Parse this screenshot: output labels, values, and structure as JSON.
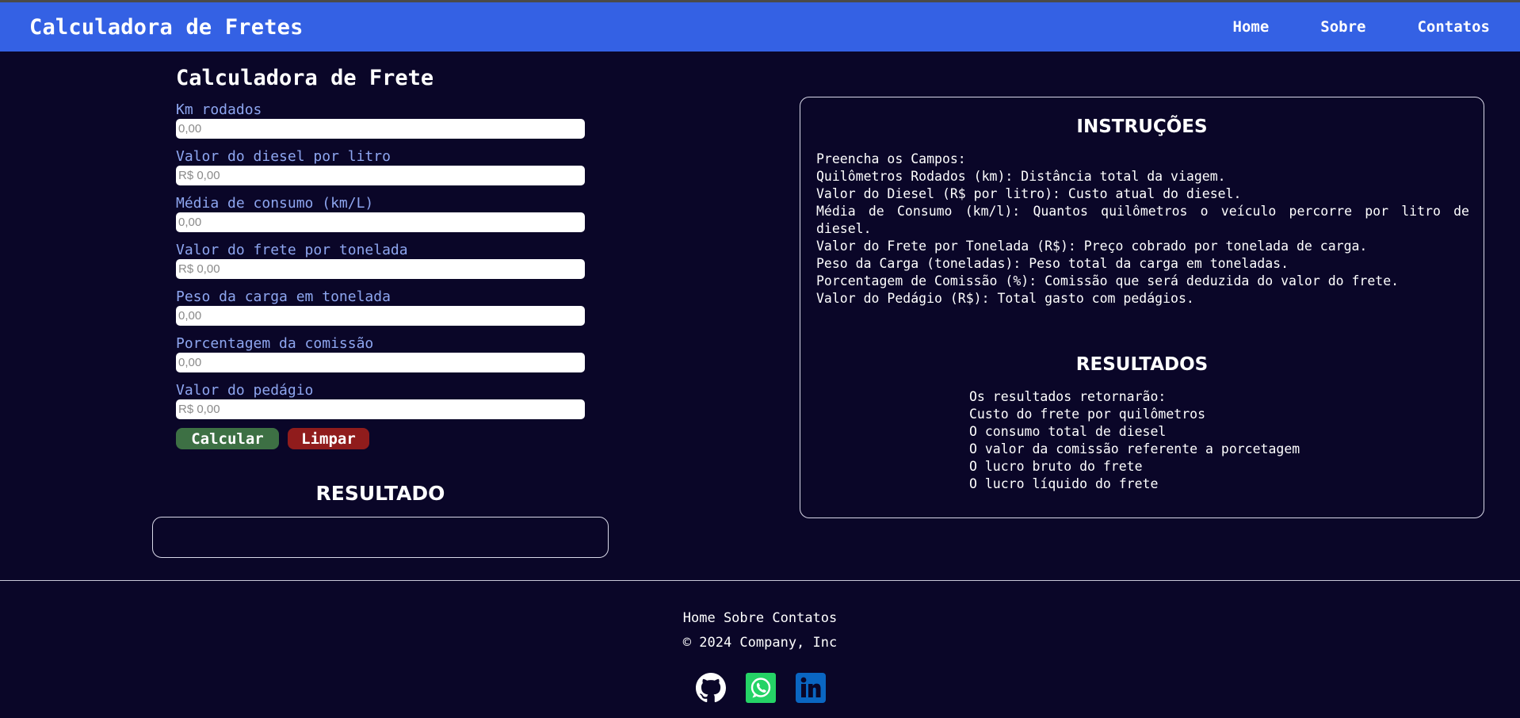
{
  "header": {
    "brand": "Calculadora de Fretes",
    "nav": [
      "Home",
      "Sobre",
      "Contatos"
    ]
  },
  "form": {
    "title": "Calculadora de Frete",
    "fields": [
      {
        "label": "Km rodados",
        "placeholder": "0,00"
      },
      {
        "label": "Valor do diesel por litro",
        "placeholder": "R$ 0,00"
      },
      {
        "label": "Média de consumo (km/L)",
        "placeholder": "0,00"
      },
      {
        "label": "Valor do frete por tonelada",
        "placeholder": "R$ 0,00"
      },
      {
        "label": "Peso da carga em tonelada",
        "placeholder": "0,00"
      },
      {
        "label": "Porcentagem da comissão",
        "placeholder": "0,00"
      },
      {
        "label": "Valor do pedágio",
        "placeholder": "R$ 0,00"
      }
    ],
    "calc_label": "Calcular",
    "clear_label": "Limpar"
  },
  "result": {
    "title": "RESULTADO",
    "value": ""
  },
  "instructions": {
    "title": "INSTRUÇÕES",
    "lines": [
      "Preencha os Campos:",
      "Quilômetros Rodados (km): Distância total da viagem.",
      "Valor do Diesel (R$ por litro): Custo atual do diesel.",
      "Média de Consumo (km/l): Quantos quilômetros o veículo percorre por litro de diesel.",
      "Valor do Frete por Tonelada (R$): Preço cobrado por tonelada de carga.",
      "Peso da Carga (toneladas): Peso total da carga em toneladas.",
      "Porcentagem de Comissão (%): Comissão que será deduzida do valor do frete.",
      "Valor do Pedágio (R$): Total gasto com pedágios."
    ]
  },
  "results_info": {
    "title": "RESULTADOS",
    "lines": [
      "Os resultados retornarão:",
      "Custo do frete por quilômetros",
      "O consumo total de diesel",
      "O valor da comissão referente a porcetagem",
      "O lucro bruto do frete",
      "O lucro líquido do frete"
    ]
  },
  "footer": {
    "links": [
      "Home",
      "Sobre",
      "Contatos"
    ],
    "copyright": "© 2024 Company, Inc",
    "socials": [
      {
        "name": "github-icon"
      },
      {
        "name": "whatsapp-icon",
        "color": "#25d366"
      },
      {
        "name": "linkedin-icon",
        "color": "#0a66c2"
      }
    ]
  },
  "colors": {
    "background": "#0a0628",
    "header": "#3461e4",
    "label": "#8ea6f0",
    "calc_button": "#3d7044",
    "clear_button": "#901c1c"
  }
}
